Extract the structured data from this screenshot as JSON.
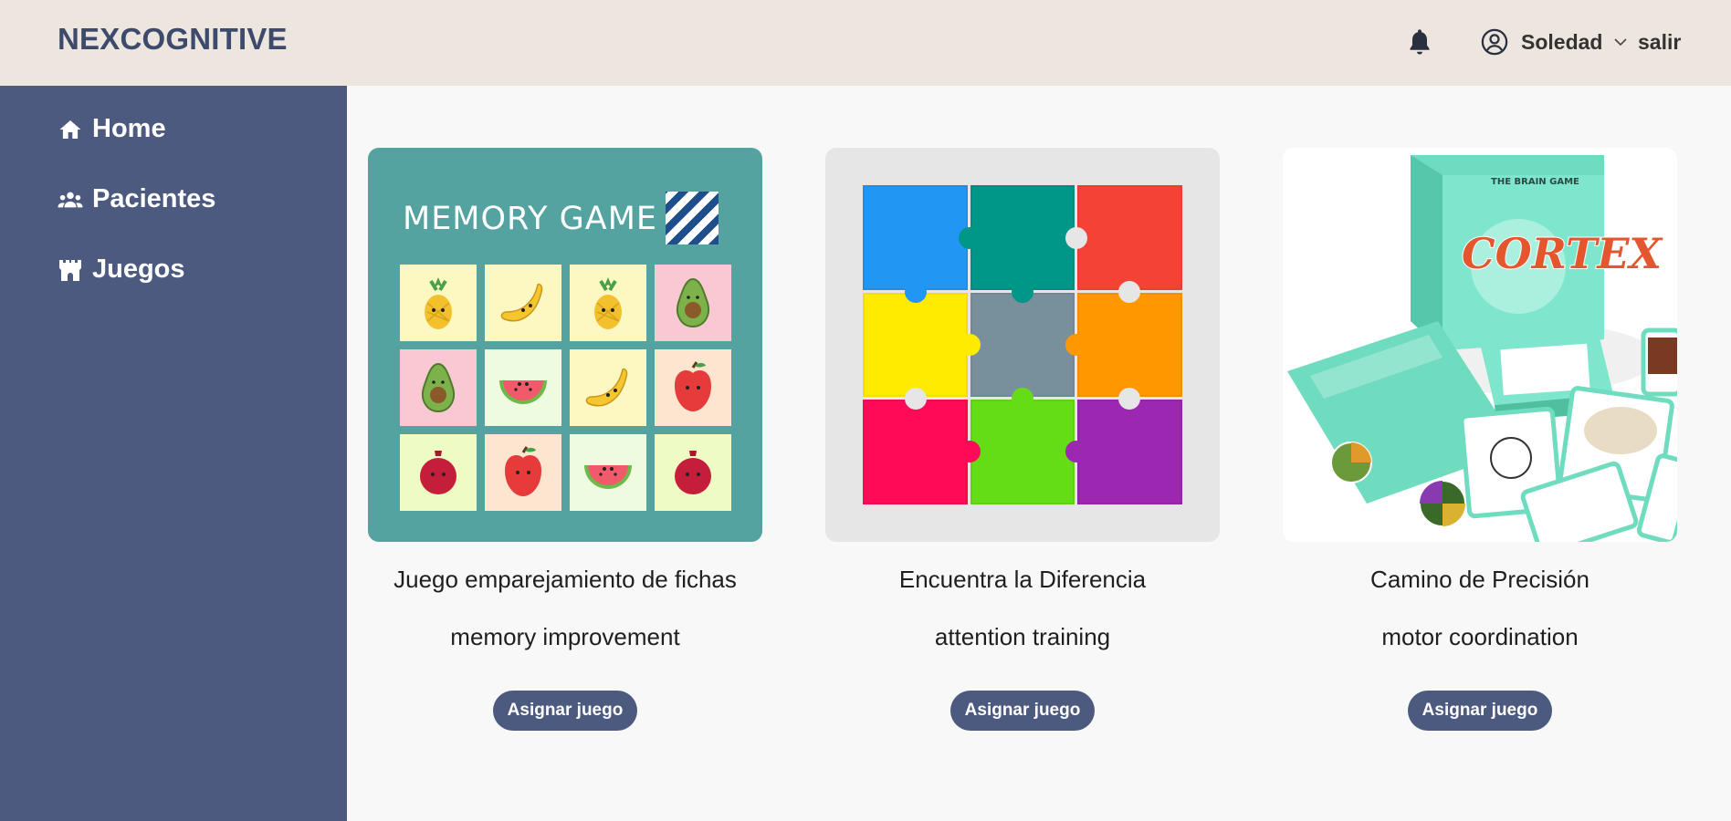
{
  "header": {
    "brand": "NEXCOGNITIVE",
    "user_name": "Soledad",
    "logout_label": "salir",
    "icons": {
      "notifications": "bell-icon",
      "user": "user-circle-icon",
      "dropdown": "chevron-down-icon"
    }
  },
  "sidebar": {
    "items": [
      {
        "label": "Home",
        "icon": "home-icon"
      },
      {
        "label": "Pacientes",
        "icon": "users-icon"
      },
      {
        "label": "Juegos",
        "icon": "castle-icon"
      }
    ]
  },
  "games": [
    {
      "title": "Juego emparejamiento de fichas",
      "subtitle": "memory improvement",
      "button_label": "Asignar juego",
      "image_caption": "MEMORY GAME"
    },
    {
      "title": "Encuentra la Diferencia",
      "subtitle": "attention training",
      "button_label": "Asignar juego"
    },
    {
      "title": "Camino de Precisión",
      "subtitle": "motor coordination",
      "button_label": "Asignar juego",
      "image_logo": "CORTEX",
      "image_tagline": "THE BRAIN GAME"
    }
  ],
  "colors": {
    "header_bg": "#ede6df",
    "sidebar_bg": "#4d5a80",
    "accent": "#4d5a80",
    "brand_text": "#3e4a6b",
    "content_bg": "#f8f8f8"
  }
}
